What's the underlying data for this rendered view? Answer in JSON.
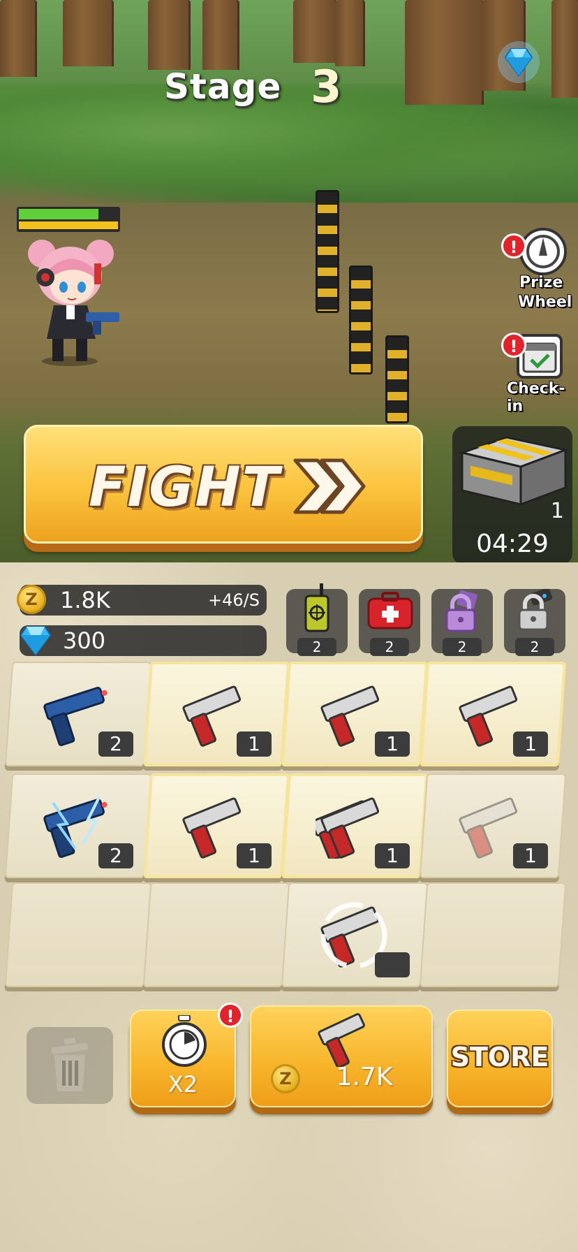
{
  "stage": {
    "label": "Stage",
    "number": "3"
  },
  "side_menu": {
    "prize_wheel": {
      "label_line1": "Prize",
      "label_line2": "Wheel",
      "alert": "!"
    },
    "check_in": {
      "label": "Check-in",
      "alert": "!"
    }
  },
  "hero": {
    "health_fraction": 0.8,
    "energy_fraction": 1.0
  },
  "fight_button": {
    "label": "FIGHT"
  },
  "crate": {
    "count": "1",
    "timer": "04:29"
  },
  "resources": {
    "coins": "1.8K",
    "coin_rate": "+46/S",
    "gems": "300",
    "coin_symbol": "Z"
  },
  "items": [
    {
      "icon": "radio-icon",
      "count": "2"
    },
    {
      "icon": "medkit-icon",
      "count": "2"
    },
    {
      "icon": "purple-lock-icon",
      "count": "2"
    },
    {
      "icon": "robot-lock-icon",
      "count": "2"
    }
  ],
  "grid": [
    {
      "weapon": "blue-pistol",
      "level": "2",
      "highlight": false
    },
    {
      "weapon": "silver-pistol",
      "level": "1",
      "highlight": true
    },
    {
      "weapon": "silver-pistol",
      "level": "1",
      "highlight": true
    },
    {
      "weapon": "silver-pistol",
      "level": "1",
      "highlight": true
    },
    {
      "weapon": "blue-pistol-electric",
      "level": "2",
      "highlight": false
    },
    {
      "weapon": "silver-pistol",
      "level": "1",
      "highlight": true
    },
    {
      "weapon": "silver-pistol-double",
      "level": "1",
      "highlight": true
    },
    {
      "weapon": "silver-pistol-faded",
      "level": "1",
      "highlight": false
    },
    {
      "weapon": "",
      "level": "",
      "highlight": false
    },
    {
      "weapon": "",
      "level": "",
      "highlight": false
    },
    {
      "weapon": "silver-pistol-spawning",
      "level": "",
      "highlight": false
    },
    {
      "weapon": "",
      "level": "",
      "highlight": false
    }
  ],
  "buttons": {
    "speed": {
      "label": "X2",
      "alert": "!"
    },
    "buy": {
      "price": "1.7K"
    },
    "store": {
      "label": "STORE"
    }
  },
  "colors": {
    "accent_orange": "#f7b42a",
    "alert_red": "#e2232b",
    "hp_green": "#5fd038",
    "energy_yellow": "#f4c21c"
  }
}
